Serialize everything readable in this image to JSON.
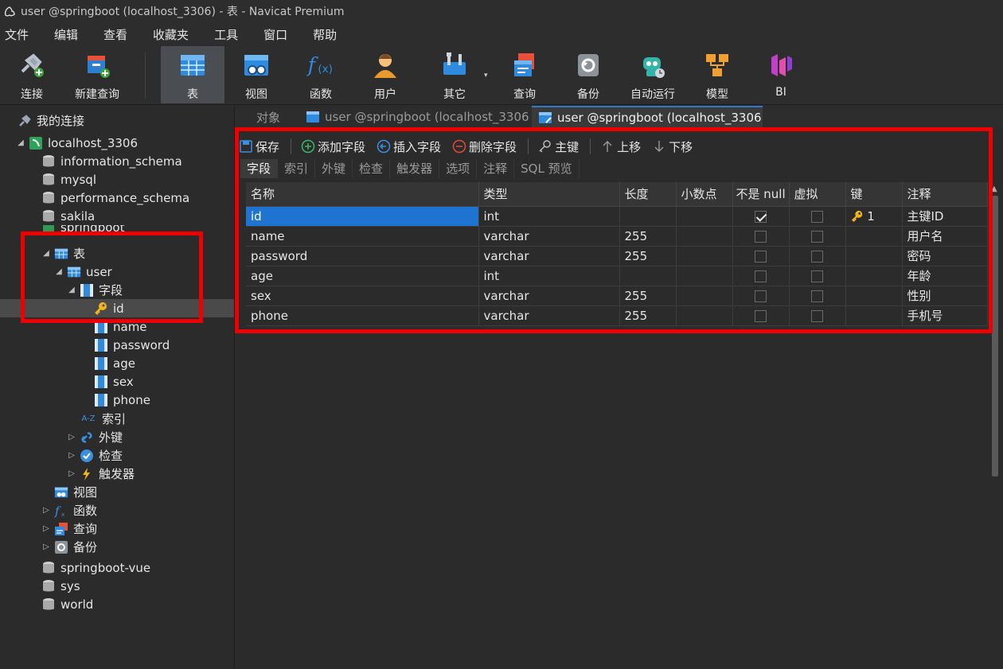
{
  "window": {
    "title": "user @springboot (localhost_3306) - 表 - Navicat Premium"
  },
  "menu": [
    "文件",
    "编辑",
    "查看",
    "收藏夹",
    "工具",
    "窗口",
    "帮助"
  ],
  "toolbar": {
    "items": [
      {
        "label": "连接",
        "icon": "connect-icon"
      },
      {
        "label": "新建查询",
        "icon": "new-query-icon"
      },
      {
        "label": "表",
        "icon": "table-icon",
        "active": true
      },
      {
        "label": "视图",
        "icon": "view-icon"
      },
      {
        "label": "函数",
        "icon": "function-icon"
      },
      {
        "label": "用户",
        "icon": "user-icon"
      },
      {
        "label": "其它",
        "icon": "tools-icon"
      },
      {
        "label": "查询",
        "icon": "query-icon"
      },
      {
        "label": "备份",
        "icon": "backup-icon"
      },
      {
        "label": "自动运行",
        "icon": "robot-icon"
      },
      {
        "label": "模型",
        "icon": "model-icon"
      },
      {
        "label": "BI",
        "icon": "bi-icon"
      }
    ]
  },
  "sidebar": {
    "header": "我的连接",
    "tree": [
      {
        "label": "localhost_3306",
        "icon": "connection-icon"
      },
      {
        "label": "information_schema",
        "icon": "database-icon"
      },
      {
        "label": "mysql",
        "icon": "database-icon"
      },
      {
        "label": "performance_schema",
        "icon": "database-icon"
      },
      {
        "label": "sakila",
        "icon": "database-icon"
      },
      {
        "label": "springboot",
        "icon": "database-icon"
      },
      {
        "label": "表",
        "icon": "table-icon"
      },
      {
        "label": "user",
        "icon": "table-icon"
      },
      {
        "label": "字段",
        "icon": "column-icon"
      },
      {
        "label": "id",
        "icon": "key-icon",
        "selected": true
      },
      {
        "label": "name",
        "icon": "column-icon"
      },
      {
        "label": "password",
        "icon": "column-icon"
      },
      {
        "label": "age",
        "icon": "column-icon"
      },
      {
        "label": "sex",
        "icon": "column-icon"
      },
      {
        "label": "phone",
        "icon": "column-icon"
      },
      {
        "label": "索引",
        "icon": "index-icon"
      },
      {
        "label": "外键",
        "icon": "foreign-key-icon"
      },
      {
        "label": "检查",
        "icon": "check-icon"
      },
      {
        "label": "触发器",
        "icon": "trigger-icon"
      },
      {
        "label": "视图",
        "icon": "view-icon"
      },
      {
        "label": "函数",
        "icon": "function-icon"
      },
      {
        "label": "查询",
        "icon": "query-icon"
      },
      {
        "label": "备份",
        "icon": "backup-icon"
      },
      {
        "label": "springboot-vue",
        "icon": "database-icon"
      },
      {
        "label": "sys",
        "icon": "database-icon"
      },
      {
        "label": "world",
        "icon": "database-icon"
      }
    ]
  },
  "tabs": [
    {
      "label": "对象"
    },
    {
      "label": "user @springboot (localhost_3306) ..."
    },
    {
      "label": "user @springboot (localhost_3306) ...",
      "active": true
    }
  ],
  "field_toolbar": {
    "save": "保存",
    "add_field": "添加字段",
    "insert_field": "插入字段",
    "delete_field": "删除字段",
    "primary_key": "主键",
    "move_up": "上移",
    "move_down": "下移"
  },
  "subtabs": [
    "字段",
    "索引",
    "外键",
    "检查",
    "触发器",
    "选项",
    "注释",
    "SQL 预览"
  ],
  "table": {
    "columns": [
      "名称",
      "类型",
      "长度",
      "小数点",
      "不是 null",
      "虚拟",
      "键",
      "注释"
    ],
    "rows": [
      {
        "name": "id",
        "type": "int",
        "length": "",
        "decimals": "",
        "not_null": true,
        "virtual": false,
        "key": "1",
        "comment": "主键ID"
      },
      {
        "name": "name",
        "type": "varchar",
        "length": "255",
        "decimals": "",
        "not_null": false,
        "virtual": false,
        "key": "",
        "comment": "用户名"
      },
      {
        "name": "password",
        "type": "varchar",
        "length": "255",
        "decimals": "",
        "not_null": false,
        "virtual": false,
        "key": "",
        "comment": "密码"
      },
      {
        "name": "age",
        "type": "int",
        "length": "",
        "decimals": "",
        "not_null": false,
        "virtual": false,
        "key": "",
        "comment": "年龄"
      },
      {
        "name": "sex",
        "type": "varchar",
        "length": "255",
        "decimals": "",
        "not_null": false,
        "virtual": false,
        "key": "",
        "comment": "性别"
      },
      {
        "name": "phone",
        "type": "varchar",
        "length": "255",
        "decimals": "",
        "not_null": false,
        "virtual": false,
        "key": "",
        "comment": "手机号"
      }
    ]
  },
  "colors": {
    "selection": "#1f74d1",
    "highlight_box": "#ee0000",
    "background": "#2b2b2b"
  }
}
